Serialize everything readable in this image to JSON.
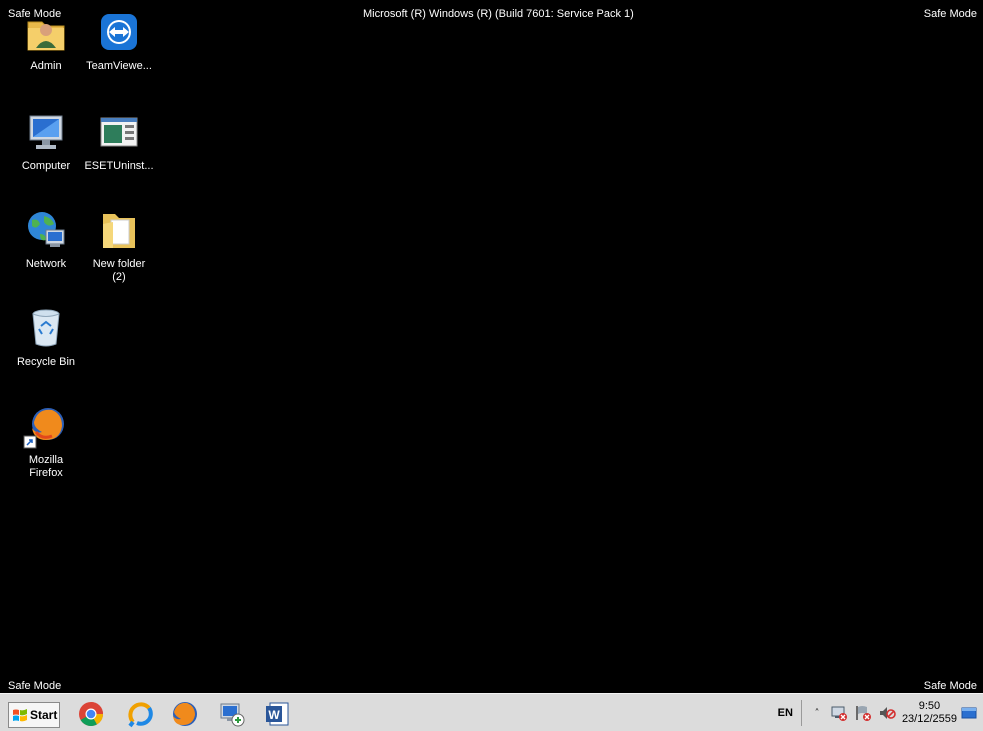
{
  "screen": {
    "safe_mode_label": "Safe Mode",
    "build_text": "Microsoft (R) Windows (R) (Build 7601: Service Pack 1)"
  },
  "desktop": {
    "icons": [
      {
        "label": "Admin",
        "icon": "user-folder-icon"
      },
      {
        "label": "TeamViewe...",
        "icon": "teamviewer-icon"
      },
      {
        "label": "Computer",
        "icon": "computer-icon"
      },
      {
        "label": "ESETUninst...",
        "icon": "eset-uninstaller-icon"
      },
      {
        "label": "Network",
        "icon": "network-icon"
      },
      {
        "label": "New folder\n(2)",
        "icon": "folder-icon"
      },
      {
        "label": "Recycle Bin",
        "icon": "recycle-bin-icon"
      },
      {
        "label": "Mozilla\nFirefox",
        "icon": "firefox-icon"
      }
    ]
  },
  "taskbar": {
    "start_label": "Start",
    "pinned": [
      "chrome-icon",
      "search-app-icon",
      "firefox-icon",
      "remote-desktop-icon",
      "word-icon"
    ],
    "tray": {
      "language": "EN",
      "show_hidden": "˄",
      "time": "9:50",
      "date": "23/12/2559"
    }
  },
  "colors": {
    "desktop_background": "#000000",
    "taskbar_background": "#dcdcdc"
  }
}
